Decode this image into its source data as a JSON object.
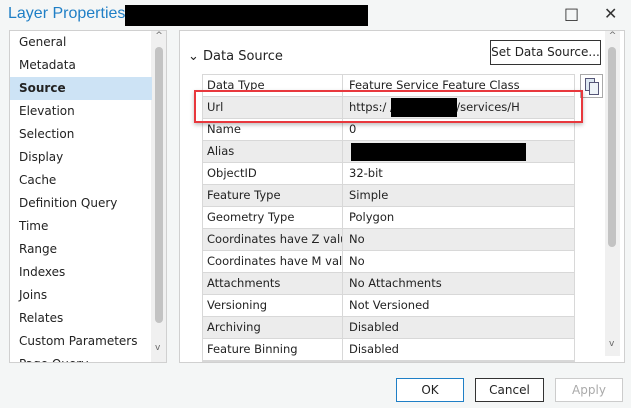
{
  "window": {
    "title": "Layer Properties:",
    "maximize_icon": "□",
    "close_icon": "✕"
  },
  "sidebar": {
    "items": [
      {
        "label": "General"
      },
      {
        "label": "Metadata"
      },
      {
        "label": "Source",
        "selected": true
      },
      {
        "label": "Elevation"
      },
      {
        "label": "Selection"
      },
      {
        "label": "Display"
      },
      {
        "label": "Cache"
      },
      {
        "label": "Definition Query"
      },
      {
        "label": "Time"
      },
      {
        "label": "Range"
      },
      {
        "label": "Indexes"
      },
      {
        "label": "Joins"
      },
      {
        "label": "Relates"
      },
      {
        "label": "Custom Parameters"
      },
      {
        "label": "Page Query"
      }
    ]
  },
  "section": {
    "title": "Data Source",
    "chevron": "⌄",
    "set_button": "Set Data Source..."
  },
  "table": {
    "rows": [
      {
        "name": "Data Type",
        "value": "Feature Service Feature Class"
      },
      {
        "name": "Url",
        "value": "https:/                       /server/rest/services/H"
      },
      {
        "name": "Name",
        "value": "0"
      },
      {
        "name": "Alias",
        "value": ""
      },
      {
        "name": "ObjectID",
        "value": "32-bit"
      },
      {
        "name": "Feature Type",
        "value": "Simple"
      },
      {
        "name": "Geometry Type",
        "value": "Polygon"
      },
      {
        "name": "Coordinates have Z value",
        "value": "No"
      },
      {
        "name": "Coordinates have M value",
        "value": "No"
      },
      {
        "name": "Attachments",
        "value": "No Attachments"
      },
      {
        "name": "Versioning",
        "value": "Not Versioned"
      },
      {
        "name": "Archiving",
        "value": "Disabled"
      },
      {
        "name": "Feature Binning",
        "value": "Disabled"
      }
    ]
  },
  "footer": {
    "ok": "OK",
    "cancel": "Cancel",
    "apply": "Apply"
  }
}
